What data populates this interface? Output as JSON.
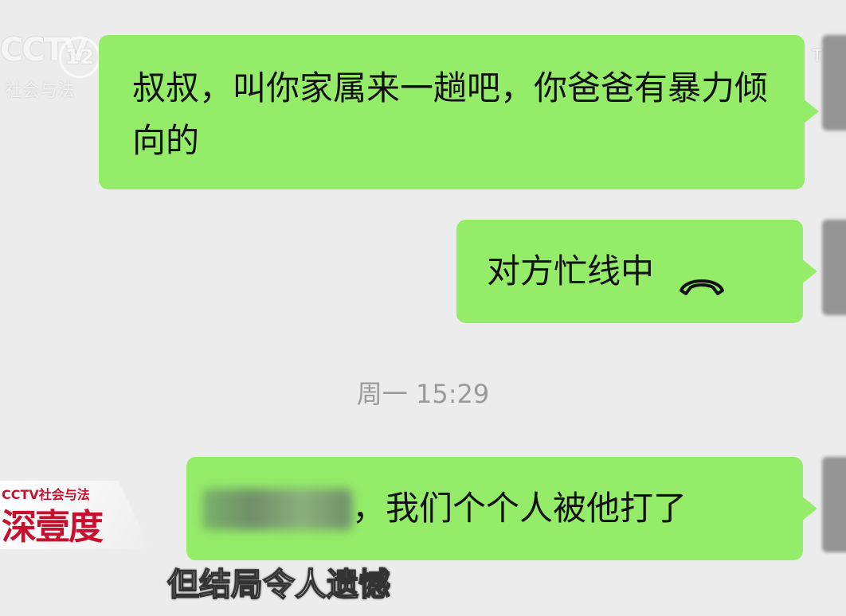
{
  "watermark": {
    "logo": "CCTV",
    "channel": "12",
    "sub": "社会与法",
    "right_partial": "T"
  },
  "messages": [
    {
      "id": "msg1",
      "direction": "outgoing",
      "text": "叔叔，叫你家属来一趟吧，你爸爸有暴力倾向的"
    },
    {
      "id": "msg2",
      "direction": "outgoing",
      "text": "对方忙线中",
      "icon": "hangup-phone-icon"
    },
    {
      "id": "msg3",
      "direction": "outgoing",
      "text": "，我们个个人被他打了",
      "redacted_prefix": true
    }
  ],
  "timestamp": "周一 15:29",
  "program_logo": {
    "small": "CCTV社会与法",
    "big": "深壹度"
  },
  "subtitle": "但结局令人遗憾",
  "colors": {
    "bubble_green": "#95ec69",
    "background": "#ececec",
    "timestamp_gray": "#9a9a9a",
    "logo_red": "#c8102e"
  }
}
